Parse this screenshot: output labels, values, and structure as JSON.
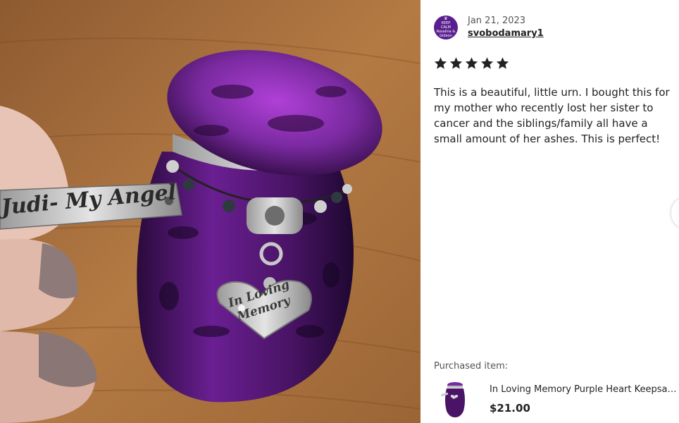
{
  "photo": {
    "tag_text": "Judi- My Angel",
    "heart_text": "In Loving Memory",
    "colors": {
      "wood": "#a5703f",
      "urn": "#5e1a86",
      "accent": "#c040e0"
    }
  },
  "review": {
    "avatar_lines": [
      "KEEP",
      "CALM",
      "Rosalina &",
      "Gideon"
    ],
    "date": "Jan 21, 2023",
    "username": "svobodamary1",
    "rating": 5,
    "rating_max": 5,
    "text": "This is a beautiful, little urn. I bought this for my mother who recently lost her sister to cancer and the siblings/family all have a small amount of her ashes. This is perfect!"
  },
  "purchased": {
    "label": "Purchased item:",
    "title": "In Loving Memory Purple Heart Keepsake Urn",
    "price": "$21.00"
  },
  "icons": {
    "star": "star-icon",
    "next": "chevron-right-icon"
  }
}
